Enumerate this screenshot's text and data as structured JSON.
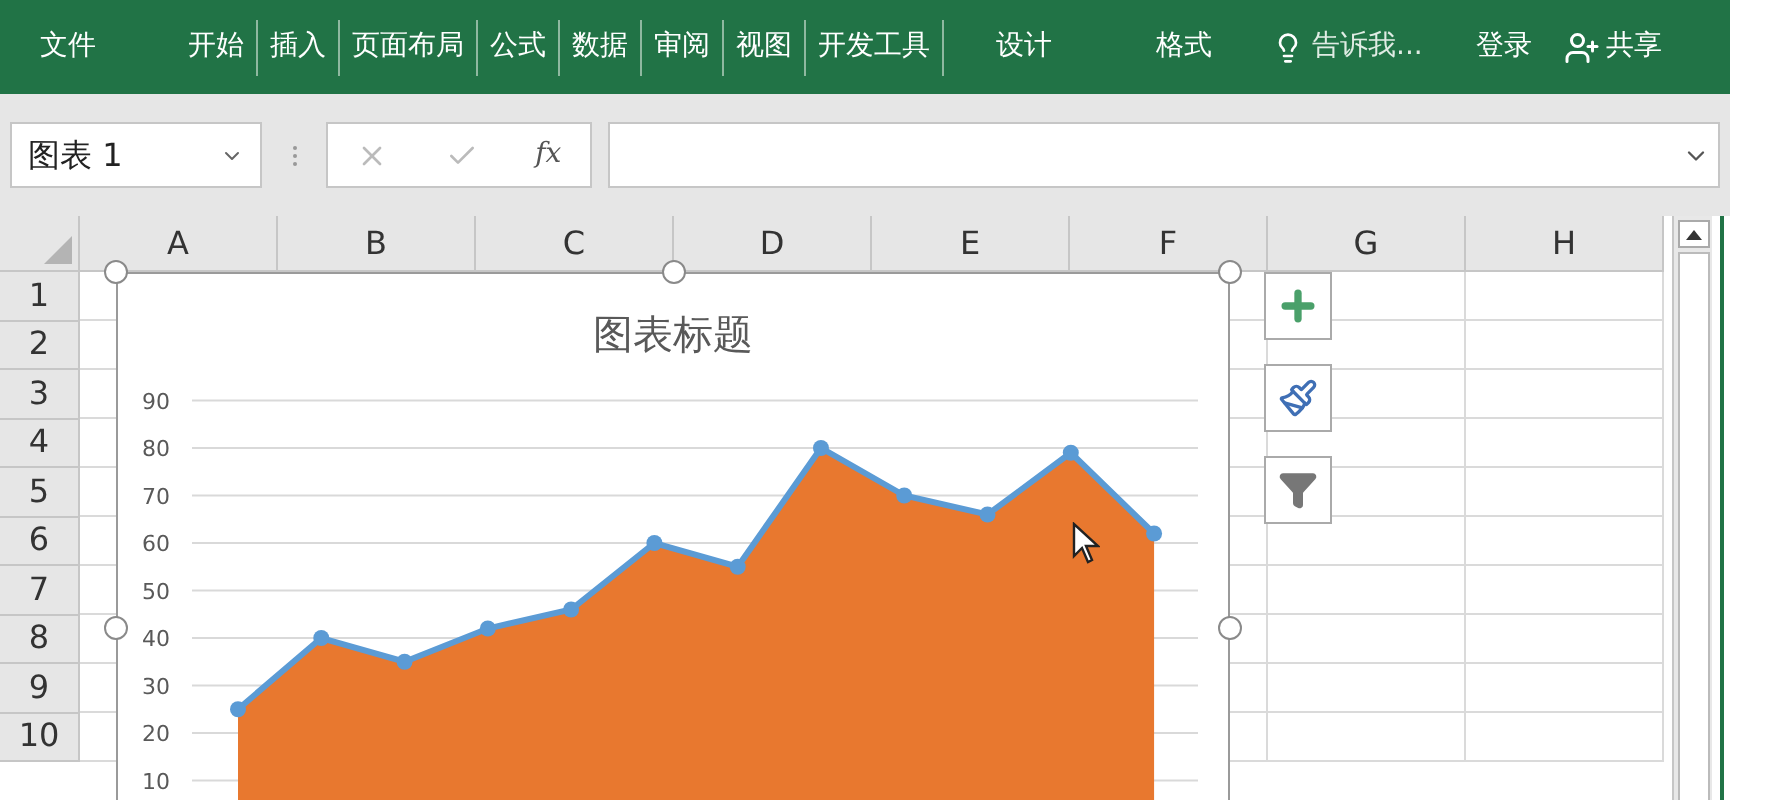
{
  "ribbon": {
    "tabs": [
      {
        "label": "文件"
      },
      {
        "label": "开始"
      },
      {
        "label": "插入"
      },
      {
        "label": "页面布局"
      },
      {
        "label": "公式"
      },
      {
        "label": "数据"
      },
      {
        "label": "审阅"
      },
      {
        "label": "视图"
      },
      {
        "label": "开发工具"
      },
      {
        "label": "设计"
      },
      {
        "label": "格式"
      }
    ],
    "tell_me": {
      "placeholder": "告诉我..."
    },
    "sign_in": "登录",
    "share": "共享"
  },
  "formula_bar": {
    "name_box": "图表 1",
    "fx": "fx",
    "cancel_disabled": true,
    "enter_disabled": true
  },
  "sheet": {
    "columns": [
      "A",
      "B",
      "C",
      "D",
      "E",
      "F",
      "G",
      "H"
    ],
    "rows": [
      "1",
      "2",
      "3",
      "4",
      "5",
      "6",
      "7",
      "8",
      "9",
      "10"
    ]
  },
  "chart": {
    "title": "图表标题",
    "chart_data": {
      "type": "area",
      "ylim": [
        0,
        90
      ],
      "grid": true,
      "yticks": [
        10,
        20,
        30,
        40,
        50,
        60,
        70,
        80,
        90
      ],
      "series": [
        {
          "type": "area",
          "color": "#e8782f",
          "values": [
            25,
            40,
            35,
            42,
            46,
            60,
            55,
            80,
            70,
            66,
            79,
            62
          ]
        },
        {
          "type": "line",
          "marker": true,
          "color": "#5b9bd5",
          "values": [
            25,
            40,
            35,
            42,
            46,
            60,
            55,
            80,
            70,
            66,
            79,
            62
          ]
        }
      ]
    }
  }
}
